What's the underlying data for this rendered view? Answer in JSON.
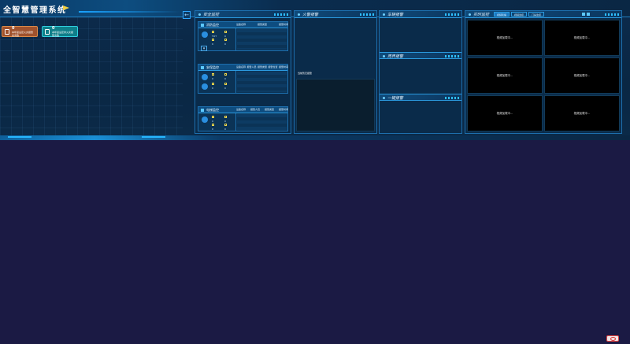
{
  "app": {
    "title": "全智慧管理系统"
  },
  "stat_cards": [
    {
      "value": "0",
      "label": "本年度设定火灾报警总次数"
    },
    {
      "value": "0",
      "label": "本年度设定非火灾报警次数"
    }
  ],
  "collapse_glyph": "←",
  "panels": {
    "safety": {
      "title": "安全监控",
      "sections": [
        {
          "label": "消防监控",
          "stats": [
            "TOT",
            "0",
            "0",
            "0"
          ],
          "columns": [
            "设备名称",
            "报警类型",
            "报警时间"
          ]
        },
        {
          "label": "安保监控",
          "stats": [
            "0",
            "0",
            "0",
            "0"
          ],
          "columns": [
            "设备名称",
            "报警人员",
            "报警类型",
            "报警位置",
            "报警时间"
          ]
        },
        {
          "label": "电梯监控",
          "stats": [
            "0",
            "0",
            "0",
            "0"
          ],
          "columns": [
            "设备名称",
            "报警人员",
            "报警类型",
            "报警时间"
          ]
        }
      ]
    },
    "fire": {
      "title": "火警报警",
      "note": "当前暂无报警"
    },
    "vehicle": {
      "title": "车辆报警"
    },
    "perimeter": {
      "title": "周界报警"
    },
    "onekey": {
      "title": "一键报警"
    },
    "live": {
      "title": "实时监控",
      "tabs": [
        "视频轮播",
        "视频监控",
        "门禁监控"
      ],
      "cells": [
        "视频加载中...",
        "视频加载中...",
        "视频加载中...",
        "视频加载中...",
        "视频加载中...",
        "视频加载中..."
      ]
    }
  },
  "colors": {
    "background": "#1b1a44",
    "panel": "#0a2b4a",
    "accent": "#2b9be0"
  }
}
